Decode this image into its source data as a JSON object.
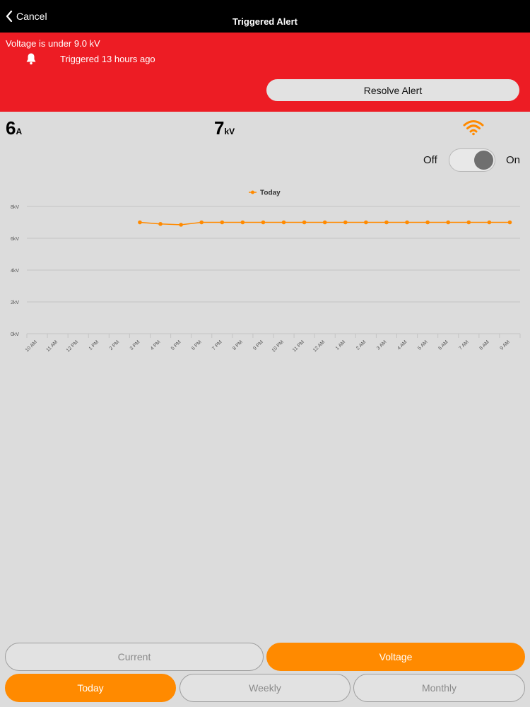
{
  "nav": {
    "back_label": "Cancel",
    "title": "Triggered Alert"
  },
  "alert": {
    "message": "Voltage is under 9.0 kV",
    "time": "Triggered 13 hours ago",
    "resolve_label": "Resolve Alert",
    "banner_color": "#ed1c24"
  },
  "readings": {
    "current_value": "6",
    "current_unit": "A",
    "voltage_value": "7",
    "voltage_unit": "kV"
  },
  "connection_icon": "wifi-icon",
  "power_toggle": {
    "off_label": "Off",
    "on_label": "On",
    "state": "on"
  },
  "chart_data": {
    "type": "line",
    "legend": [
      "Today"
    ],
    "legend_position": "top-center",
    "grid": true,
    "ylim": [
      0,
      8
    ],
    "y_ticks": [
      "0kV",
      "2kV",
      "4kV",
      "6kV",
      "8kV"
    ],
    "x": [
      "10 AM",
      "11 AM",
      "12 PM",
      "1 PM",
      "2 PM",
      "3 PM",
      "4 PM",
      "5 PM",
      "6 PM",
      "7 PM",
      "8 PM",
      "9 PM",
      "10 PM",
      "11 PM",
      "12 AM",
      "1 AM",
      "2 AM",
      "3 AM",
      "4 AM",
      "5 AM",
      "6 AM",
      "7 AM",
      "8 AM",
      "9 AM"
    ],
    "series": [
      {
        "name": "Today",
        "color": "#ff8a00",
        "values": [
          null,
          null,
          null,
          null,
          null,
          7.0,
          6.9,
          6.85,
          7.0,
          7.0,
          7.0,
          7.0,
          7.0,
          7.0,
          7.0,
          7.0,
          7.0,
          7.0,
          7.0,
          7.0,
          7.0,
          7.0,
          7.0,
          7.0
        ]
      }
    ]
  },
  "metric_tabs": [
    {
      "label": "Current",
      "active": false
    },
    {
      "label": "Voltage",
      "active": true
    }
  ],
  "period_tabs": [
    {
      "label": "Today",
      "active": true
    },
    {
      "label": "Weekly",
      "active": false
    },
    {
      "label": "Monthly",
      "active": false
    }
  ],
  "colors": {
    "accent": "#ff8a00",
    "background": "#dcdcdc"
  }
}
